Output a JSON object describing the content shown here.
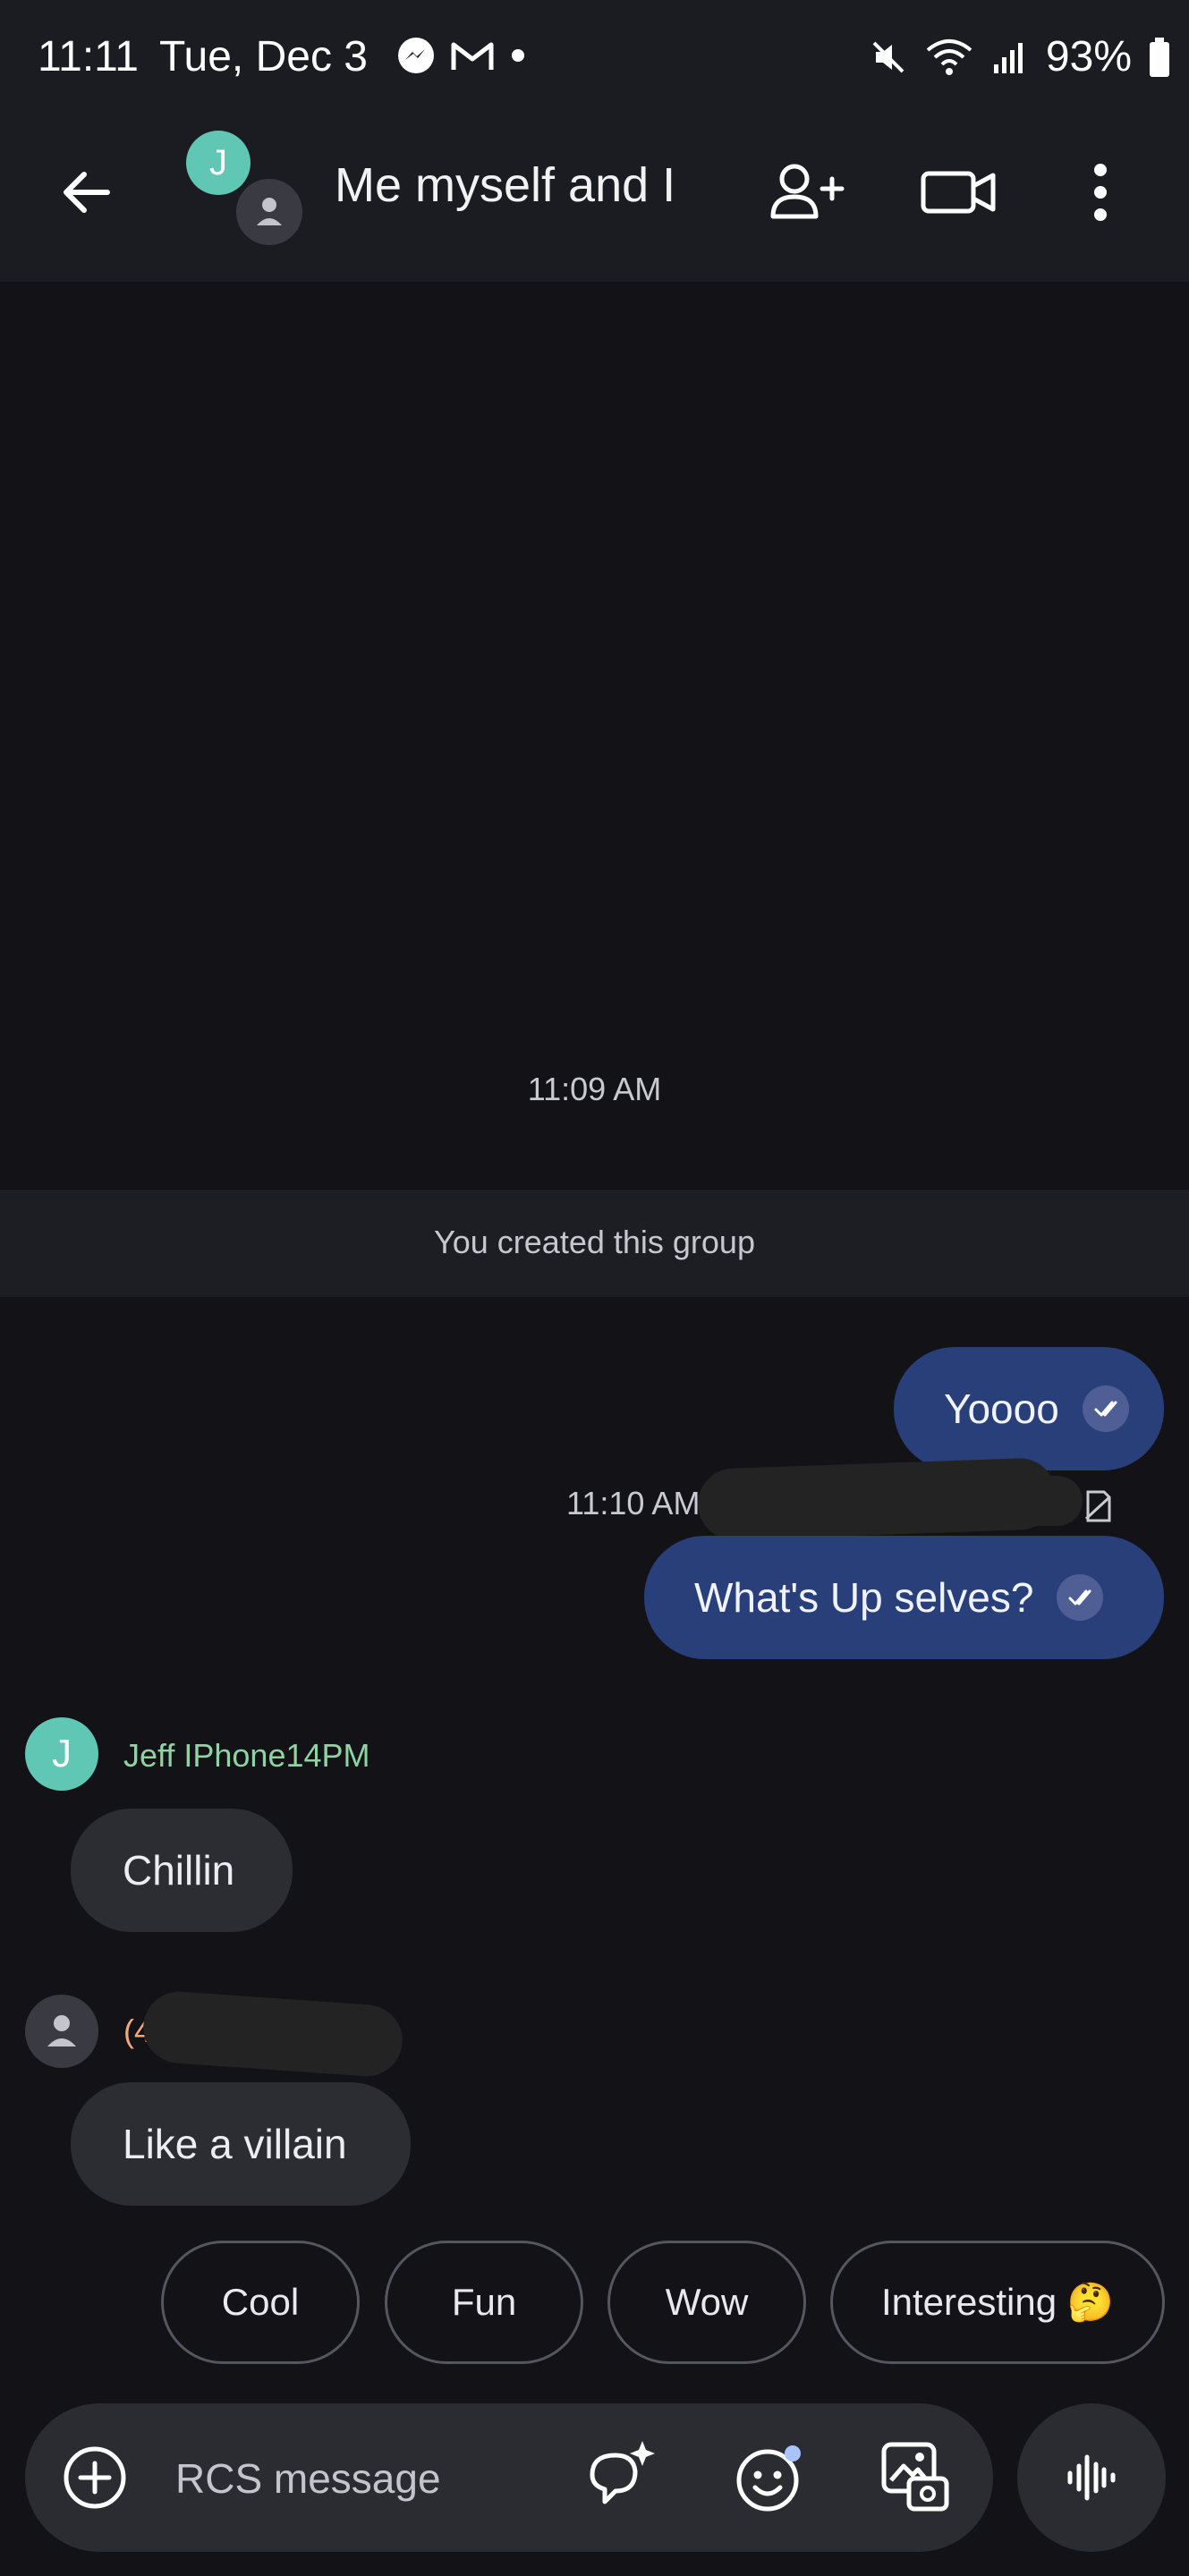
{
  "status_bar": {
    "time": "11:11",
    "date": "Tue, Dec 3",
    "battery": "93%"
  },
  "app_bar": {
    "title": "Me myself and I",
    "avatar_letter": "J"
  },
  "conversation": {
    "timestamp_1": "11:09 AM",
    "system_message": "You created this group",
    "messages_out": [
      {
        "text": "Yoooo"
      },
      {
        "text": "What's Up selves?"
      }
    ],
    "timestamp_2": "11:10 AM",
    "incoming": [
      {
        "avatar_letter": "J",
        "sender": "Jeff IPhone14PM",
        "text": "Chillin"
      },
      {
        "sender": "(4",
        "text": "Like a villain"
      }
    ]
  },
  "smart_replies": [
    "Cool",
    "Fun",
    "Wow",
    "Interesting 🤔"
  ],
  "compose": {
    "placeholder": "RCS message"
  },
  "colors": {
    "background": "#121217",
    "appbar": "#1b1c21",
    "outgoing_bubble": "#283f7a",
    "incoming_bubble": "#2c2d33",
    "avatar_teal": "#5fc7b4",
    "sender_green": "#8fd3a3",
    "sender_orange": "#f3a87a"
  },
  "icons": {
    "back": "arrow-left",
    "add_person": "person-add",
    "video": "video-camera",
    "more": "more-vertical",
    "add": "plus-circle",
    "magic_compose": "sparkle-chat",
    "emoji": "smiley",
    "gallery": "image-gallery",
    "voice": "voice-waveform"
  }
}
